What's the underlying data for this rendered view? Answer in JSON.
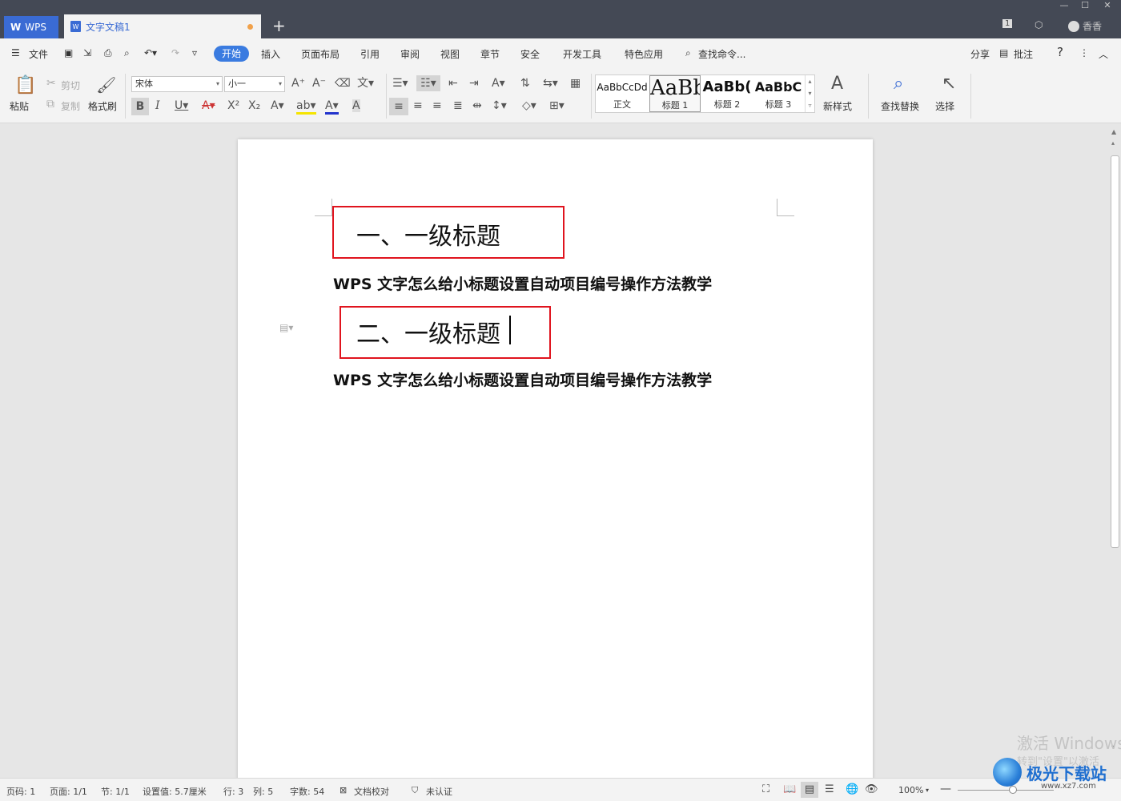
{
  "titlebar": {
    "wps_tab": "WPS",
    "doc_tab": "文字文稿1",
    "user": "香香",
    "badge": "1"
  },
  "menu": {
    "file": "文件",
    "tabs": [
      "开始",
      "插入",
      "页面布局",
      "引用",
      "审阅",
      "视图",
      "章节",
      "安全",
      "开发工具",
      "特色应用"
    ],
    "search": "查找命令...",
    "share": "分享",
    "comment": "批注",
    "help": "?"
  },
  "ribbon": {
    "paste": "粘贴",
    "cut": "剪切",
    "copy": "复制",
    "format_painter": "格式刷",
    "font_name": "宋体",
    "font_size": "小一",
    "styles": [
      {
        "preview": "AaBbCcDd",
        "label": "正文"
      },
      {
        "preview": "AaBb",
        "label": "标题 1"
      },
      {
        "preview": "AaBb(",
        "label": "标题 2"
      },
      {
        "preview": "AaBbC",
        "label": "标题 3"
      }
    ],
    "new_style": "新样式",
    "find_replace": "查找替换",
    "select": "选择"
  },
  "document": {
    "heading1": "一、一级标题",
    "body1": "WPS 文字怎么给小标题设置自动项目编号操作方法教学",
    "heading2": "二、一级标题",
    "body2": "WPS 文字怎么给小标题设置自动项目编号操作方法教学"
  },
  "status": {
    "page_code": "页码: 1",
    "pages": "页面: 1/1",
    "section": "节: 1/1",
    "setting": "设置值: 5.7厘米",
    "row": "行: 3",
    "col": "列: 5",
    "words": "字数: 54",
    "proof": "文档校对",
    "cert": "未认证",
    "zoom": "100%"
  },
  "watermark": {
    "activate": "激活 Windows",
    "activate_sub": "转到\"设置\"以激活",
    "site": "极光下载站",
    "site_url": "www.xz7.com"
  },
  "colors": {
    "titlebar": "#444955",
    "accent": "#3a7be0",
    "red_box": "#e0141e"
  }
}
